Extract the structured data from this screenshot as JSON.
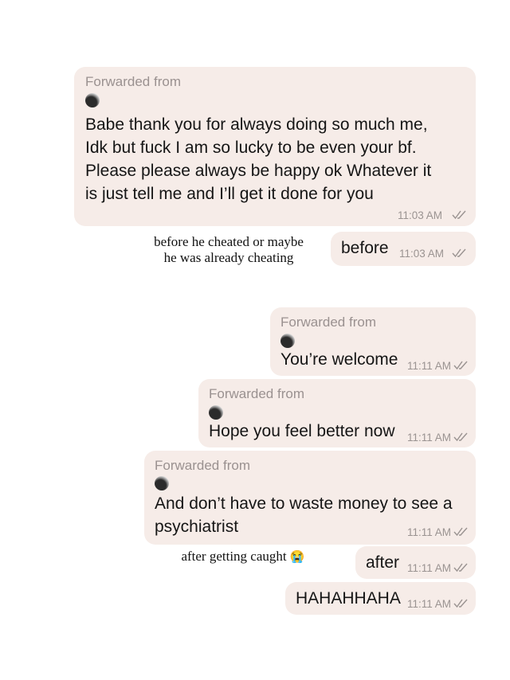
{
  "forwarded_label": "Forwarded from",
  "messages": [
    {
      "forwarded": true,
      "lines": [
        "Babe thank you for always doing so much me,",
        "Idk but fuck I am so lucky to be even your bf.",
        "Please please always be happy ok Whatever it",
        "is just tell me and I’ll get it done for you"
      ],
      "time": "11:03 AM"
    },
    {
      "forwarded": false,
      "text": "before",
      "time": "11:03 AM"
    },
    {
      "forwarded": true,
      "text": "You’re welcome",
      "time": "11:11 AM"
    },
    {
      "forwarded": true,
      "text": "Hope you feel better now",
      "time": "11:11 AM"
    },
    {
      "forwarded": true,
      "lines": [
        "And don’t have to waste money to see a",
        "psychiatrist"
      ],
      "time": "11:11 AM"
    },
    {
      "forwarded": false,
      "text": "after",
      "time": "11:11 AM"
    },
    {
      "forwarded": false,
      "text": "HAHAHHAHA",
      "time": "11:11 AM"
    }
  ],
  "captions": {
    "before_line1": "before he cheated or maybe",
    "before_line2": "he was already cheating",
    "after": "after getting caught",
    "after_emoji": "😭"
  }
}
